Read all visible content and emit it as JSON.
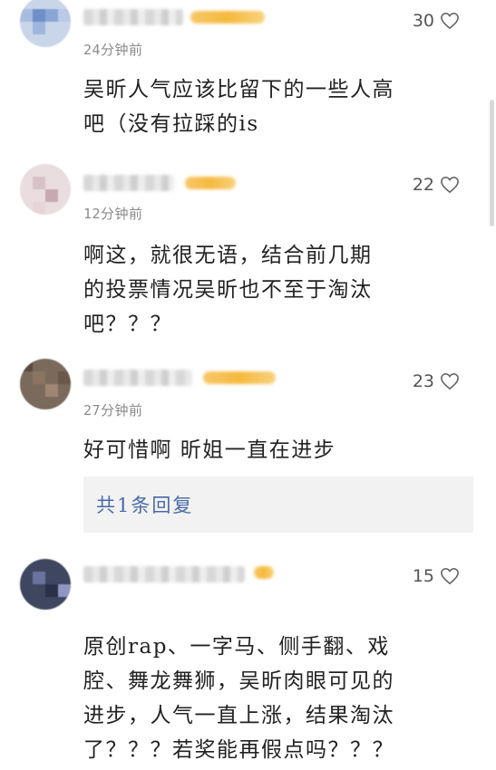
{
  "comments": [
    {
      "time": "24分钟前",
      "likes": "30",
      "text_lines": [
        "吴昕人气应该比留下的一些人高",
        "吧（没有拉踩的is"
      ]
    },
    {
      "time": "12分钟前",
      "likes": "22",
      "text_lines": [
        "啊这，就很无语，结合前几期",
        "的投票情况吴昕也不至于淘汰",
        "吧？？？"
      ]
    },
    {
      "time": "27分钟前",
      "likes": "23",
      "text_lines": [
        "好可惜啊 昕姐一直在进步"
      ],
      "reply_label": "共1条回复"
    },
    {
      "likes": "15",
      "text_lines": [
        "原创rap、一字马、侧手翻、戏",
        "腔、舞龙舞狮，吴昕肉眼可见的",
        "进步，人气一直上涨，结果淘汰",
        "了？？？若奖能再假点吗？？？"
      ]
    }
  ],
  "icons": {
    "like": "heart-outline-icon"
  }
}
